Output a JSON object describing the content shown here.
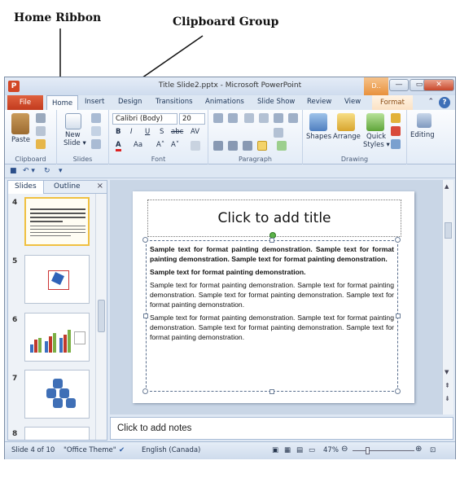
{
  "annotations": {
    "home_ribbon": "Home Ribbon",
    "clipboard_group": "Clipboard Group"
  },
  "window": {
    "title": "Title Slide2.pptx  -  Microsoft PowerPoint",
    "app_icon": "P",
    "context_header": "D..",
    "minimize": "—",
    "restore": "▭",
    "close": "✕"
  },
  "tabs": {
    "file": "File",
    "home": "Home",
    "insert": "Insert",
    "design": "Design",
    "transitions": "Transitions",
    "animations": "Animations",
    "slide_show": "Slide Show",
    "review": "Review",
    "view": "View",
    "format": "Format",
    "collapse": "⌃",
    "help": "?"
  },
  "ribbon": {
    "clipboard": {
      "label": "Clipboard",
      "paste": "Paste"
    },
    "slides": {
      "label": "Slides",
      "new_slide_line1": "New",
      "new_slide_line2": "Slide ▾"
    },
    "font": {
      "label": "Font",
      "font_name": "Calibri (Body)",
      "font_size": "20",
      "bold": "B",
      "italic": "I",
      "underline": "U",
      "shadow": "S",
      "strike": "abc",
      "spacing": "AV",
      "font_color": "A",
      "change_case": "Aa",
      "grow": "A˄",
      "shrink": "A˅"
    },
    "paragraph": {
      "label": "Paragraph"
    },
    "drawing": {
      "label": "Drawing",
      "shapes": "Shapes",
      "arrange": "Arrange",
      "quick_styles_line1": "Quick",
      "quick_styles_line2": "Styles ▾"
    },
    "editing": {
      "label": "Editing",
      "editing": "Editing"
    }
  },
  "qat": {
    "save": "■",
    "undo": "↶ ▾",
    "redo": "↻",
    "customize": "▾"
  },
  "slides_pane": {
    "tab_slides": "Slides",
    "tab_outline": "Outline",
    "close": "×",
    "thumbnails": [
      {
        "num": "4",
        "selected": true
      },
      {
        "num": "5",
        "selected": false
      },
      {
        "num": "6",
        "selected": false
      },
      {
        "num": "7",
        "selected": false
      },
      {
        "num": "8",
        "selected": false
      }
    ]
  },
  "slide": {
    "title_placeholder": "Click to add title",
    "paragraphs_bold": [
      "Sample text for format painting demonstration. Sample text for format painting demonstration. Sample text for format painting demonstration.",
      "Sample text for format painting demonstration."
    ],
    "paragraphs": [
      "Sample text for format painting demonstration. Sample text for format painting demonstration. Sample text for format painting demonstration. Sample text for format painting demonstration.",
      "Sample text for format painting demonstration. Sample text for format painting demonstration. Sample text for format painting demonstration. Sample text for format painting demonstration."
    ]
  },
  "notes": {
    "placeholder": "Click to add notes"
  },
  "status": {
    "slide_count": "Slide 4 of 10",
    "theme": "\"Office Theme\"",
    "language": "English (Canada)",
    "zoom": "47%",
    "zoom_out": "⊖",
    "zoom_in": "⊕"
  },
  "colors": {
    "file_tab": "#c23b1e",
    "ribbon_bg": "#e3ecf7",
    "selected_thumb": "#f0c040",
    "slide_area_bg": "#c9d6e6"
  }
}
